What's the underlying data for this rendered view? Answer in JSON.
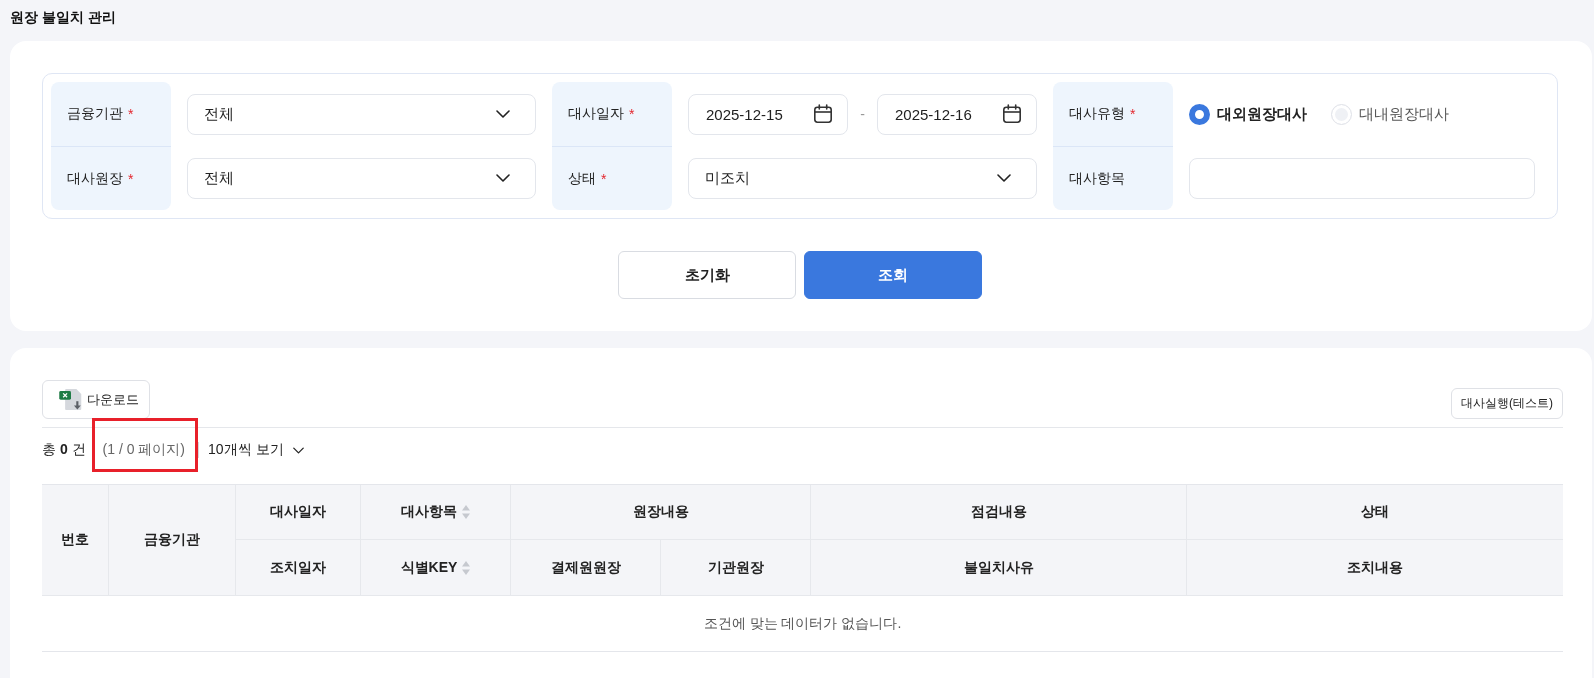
{
  "page": {
    "title": "원장 불일치 관리"
  },
  "filters": [
    {
      "kind": "select",
      "label": "금융기관",
      "required_mark": "*",
      "value": "전체"
    },
    {
      "kind": "date_range",
      "label": "대사일자",
      "required_mark": "*",
      "start": "2025-12-15",
      "separator": "-",
      "end": "2025-12-16"
    },
    {
      "kind": "radio",
      "label": "대사유형",
      "required_mark": "*",
      "options": [
        {
          "label": "대외원장대사",
          "selected": true
        },
        {
          "label": "대내원장대사",
          "selected": false
        }
      ]
    },
    {
      "kind": "select",
      "label": "대사원장",
      "required_mark": "*",
      "value": "전체"
    },
    {
      "kind": "select",
      "label": "상태",
      "required_mark": "*",
      "value": "미조치"
    },
    {
      "kind": "text",
      "label": "대사항목"
    }
  ],
  "actions": [
    {
      "kind": "secondary",
      "label": "초기화"
    },
    {
      "kind": "primary",
      "label": "조회"
    }
  ],
  "results": {
    "toolbar": {
      "download_button": "다운로드",
      "run_button": "대사실행(테스트)"
    },
    "summary": {
      "total": "총 **0** 건",
      "page_info": "(1 / 0 페이지)",
      "highlighted": true,
      "page_size": "10개씩 보기"
    },
    "table": {
      "columns": [
        {
          "kind": "single",
          "label": "번호",
          "sortable": false
        },
        {
          "kind": "single",
          "label": "금융기관",
          "sortable": false
        },
        {
          "kind": "stacked",
          "top": {
            "label": "대사일자",
            "sortable": false
          },
          "bottom": {
            "label": "조치일자",
            "sortable": false
          }
        },
        {
          "kind": "stacked",
          "top": {
            "label": "대사항목",
            "sortable": true
          },
          "bottom": {
            "label": "식별KEY",
            "sortable": true
          }
        },
        {
          "kind": "group",
          "label": "원장내용",
          "sortable": false,
          "children": [
            {
              "label": "결제원원장",
              "sortable": false
            },
            {
              "label": "기관원장",
              "sortable": false
            }
          ]
        },
        {
          "kind": "stacked",
          "top": {
            "label": "점검내용",
            "sortable": false
          },
          "bottom": {
            "label": "불일치사유",
            "sortable": false
          }
        },
        {
          "kind": "stacked",
          "top": {
            "label": "상태",
            "sortable": false
          },
          "bottom": {
            "label": "조치내용",
            "sortable": false
          }
        }
      ],
      "empty_message": "조건에 맞는 데이터가 없습니다."
    }
  }
}
